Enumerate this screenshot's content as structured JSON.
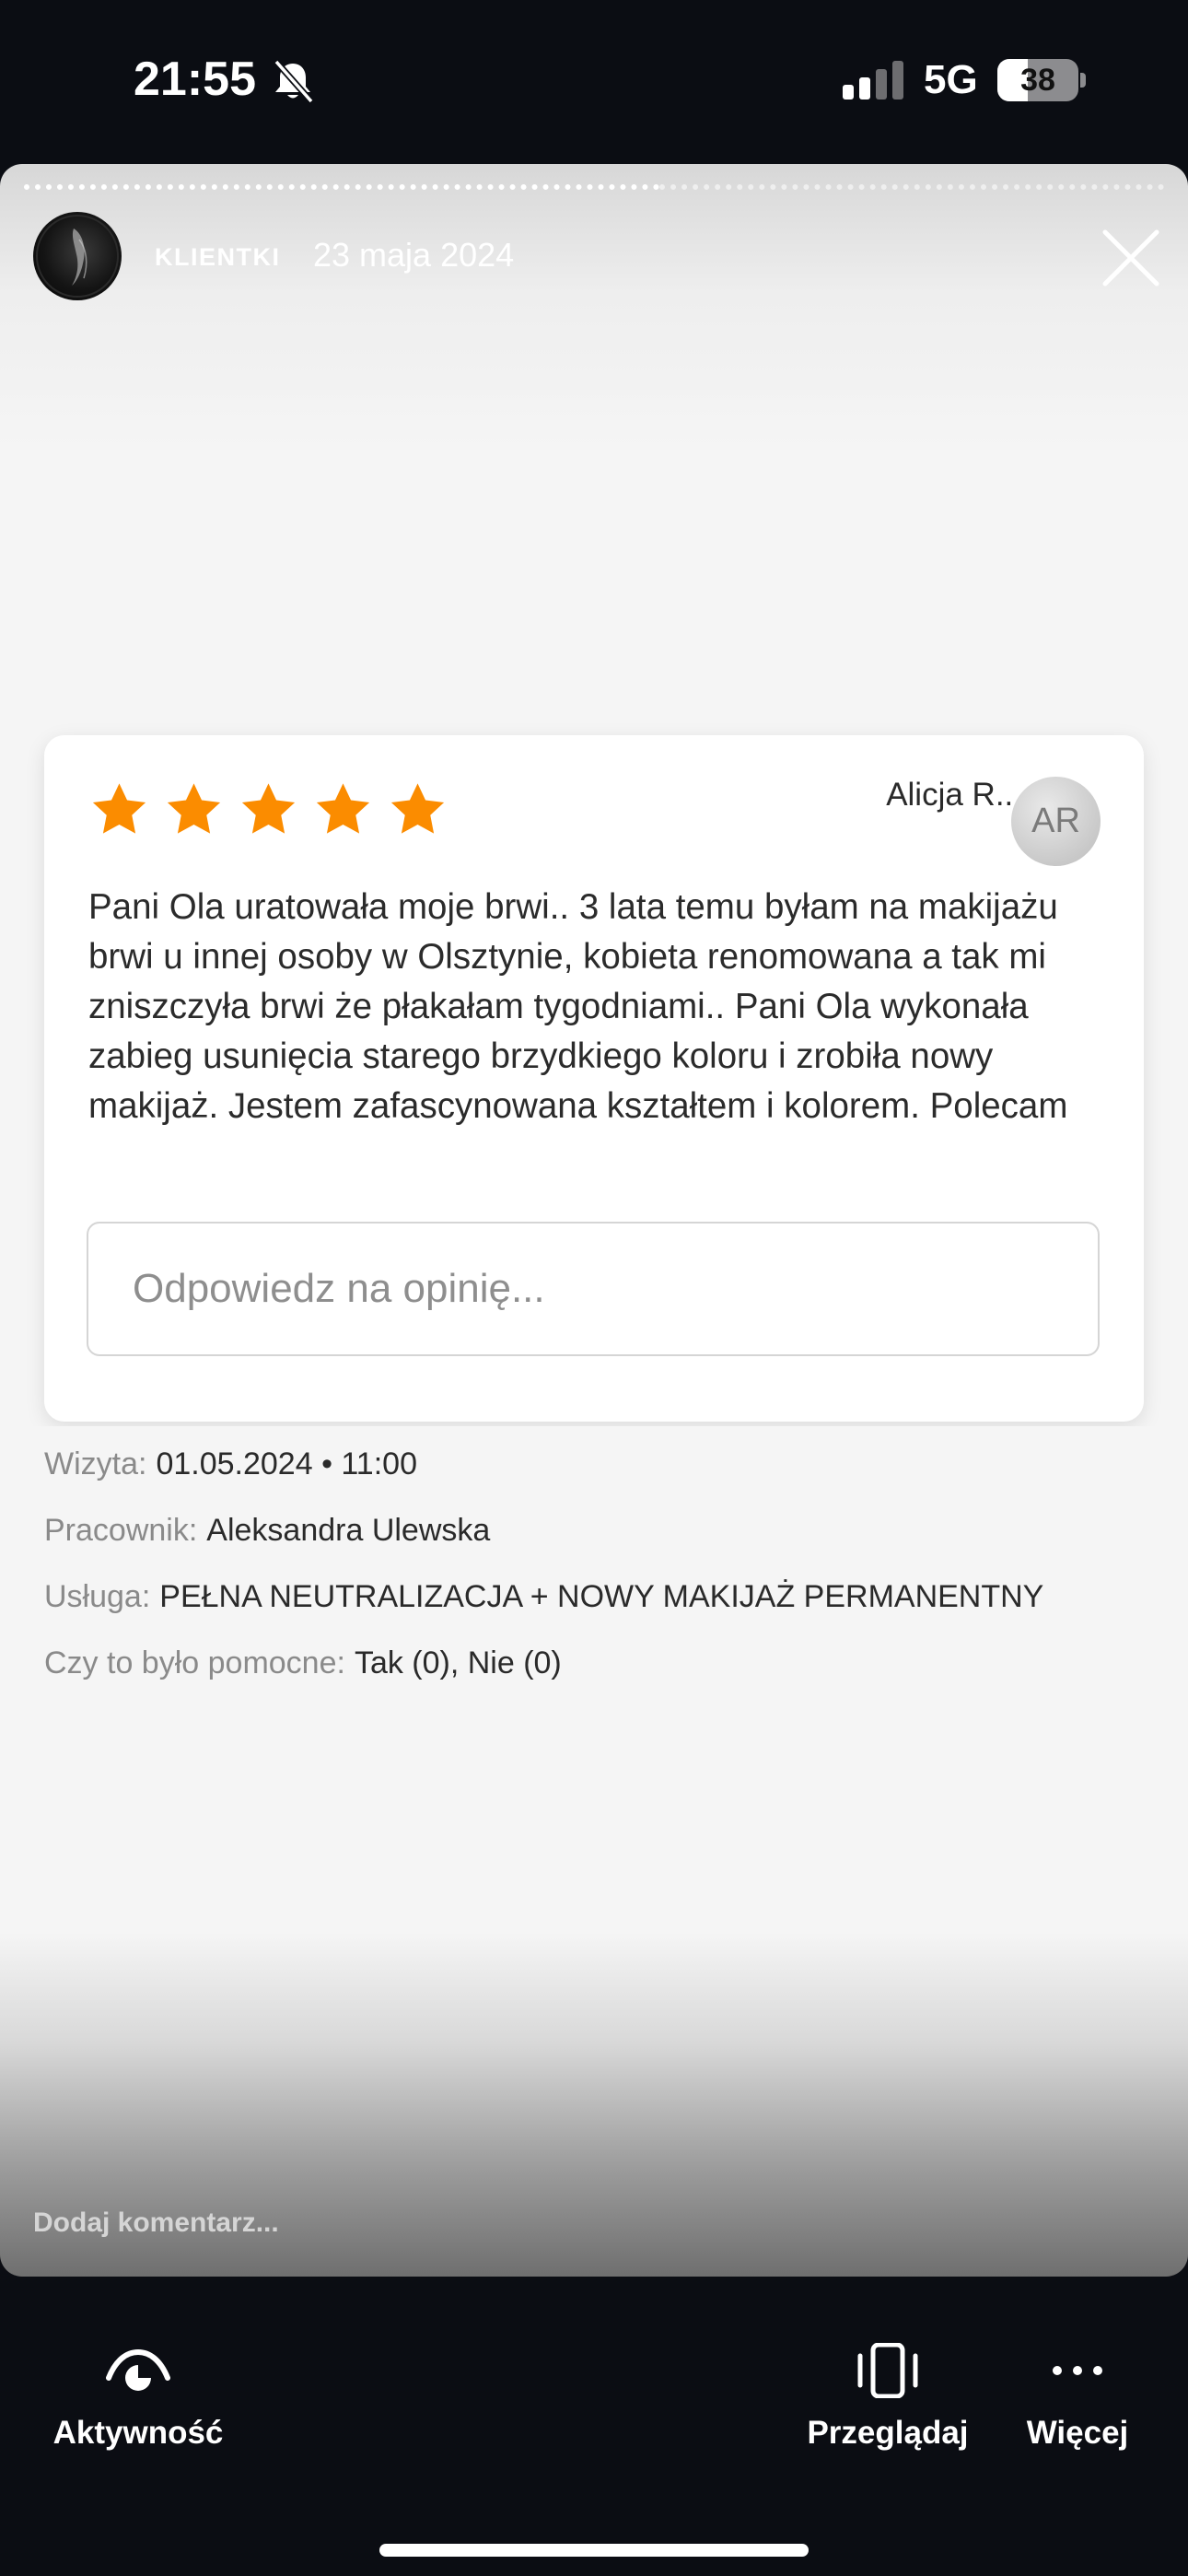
{
  "status_bar": {
    "time": "21:55",
    "network": "5G",
    "battery": "38",
    "battery_level": 0.38
  },
  "story": {
    "user": "KLIENTKI",
    "date": "23 maja 2024"
  },
  "review": {
    "rating": 5,
    "reviewer_name": "Alicja R...",
    "reviewer_initials": "AR",
    "text": "Pani Ola uratowała moje brwi.. 3 lata temu byłam na makijażu brwi u innej osoby w Olsztynie, kobieta renomowana a tak mi zniszczyła brwi że płakałam tygodniami.. Pani Ola wykonała zabieg usunięcia starego brzydkiego koloru i zrobiła nowy makijaż. Jestem zafascynowana kształtem i kolorem. Polecam",
    "reply_placeholder": "Odpowiedz na opinię..."
  },
  "meta": {
    "visit_label": "Wizyta:",
    "visit_value": "01.05.2024 • 11:00",
    "employee_label": "Pracownik:",
    "employee_value": "Aleksandra Ulewska",
    "service_label": "Usługa:",
    "service_value": "PEŁNA NEUTRALIZACJA + NOWY MAKIJAŻ PERMANENTNY",
    "helpful_label": "Czy to było pomocne:",
    "helpful_value": "Tak (0), Nie (0)"
  },
  "comment": {
    "placeholder": "Dodaj komentarz..."
  },
  "bottom_bar": {
    "activity": "Aktywność",
    "browse": "Przeglądaj",
    "more": "Więcej"
  },
  "colors": {
    "star": "#fb8c00",
    "background": "#0b0d13"
  }
}
